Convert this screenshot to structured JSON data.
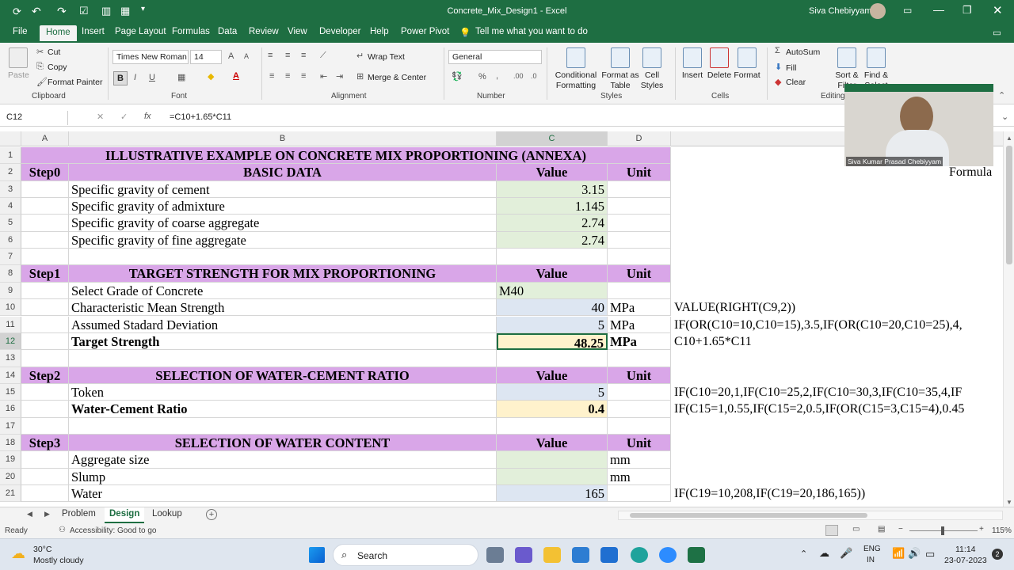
{
  "titlebar": {
    "title": "Concrete_Mix_Design1  -  Excel",
    "user": "Siva Chebiyyam"
  },
  "menu": [
    "File",
    "Home",
    "Insert",
    "Page Layout",
    "Formulas",
    "Data",
    "Review",
    "View",
    "Developer",
    "Help",
    "Power Pivot"
  ],
  "tell_me": "Tell me what you want to do",
  "ribbon": {
    "cut": "Cut",
    "copy": "Copy",
    "format_painter": "Format Painter",
    "paste": "Paste",
    "font_name": "Times New Roman",
    "font_size": "14",
    "wrap_text": "Wrap Text",
    "merge_center": "Merge & Center",
    "number_format": "General",
    "conditional_formatting": "Conditional Formatting",
    "format_as_table": "Format as Table",
    "cell_styles": "Cell Styles",
    "insert": "Insert",
    "delete": "Delete",
    "format": "Format",
    "autosum": "AutoSum",
    "fill": "Fill",
    "clear": "Clear",
    "sort_filter": "Sort & Filter",
    "find_select": "Find & Select",
    "groups": {
      "clipboard": "Clipboard",
      "font": "Font",
      "alignment": "Alignment",
      "number": "Number",
      "styles": "Styles",
      "cells": "Cells",
      "editing": "Editing"
    }
  },
  "formula_bar": {
    "name_box": "C12",
    "formula": "=C10+1.65*C11"
  },
  "columns": [
    "A",
    "B",
    "C",
    "D"
  ],
  "rows": [
    {
      "n": "1",
      "title": "ILLUSTRATIVE EXAMPLE ON CONCRETE MIX PROPORTIONING (ANNEXA)"
    },
    {
      "n": "2",
      "a": "Step0",
      "b": "BASIC DATA",
      "c": "Value",
      "d": "Unit",
      "f": "Formula"
    },
    {
      "n": "3",
      "b": "Specific gravity of cement",
      "c": "3.15"
    },
    {
      "n": "4",
      "b": "Specific gravity of admixture",
      "c": "1.145"
    },
    {
      "n": "5",
      "b": "Specific gravity of coarse aggregate",
      "c": "2.74"
    },
    {
      "n": "6",
      "b": "Specific gravity of fine aggregate",
      "c": "2.74"
    },
    {
      "n": "7"
    },
    {
      "n": "8",
      "a": "Step1",
      "b": "TARGET STRENGTH FOR MIX PROPORTIONING",
      "c": "Value",
      "d": "Unit"
    },
    {
      "n": "9",
      "b": "Select Grade of Concrete",
      "c": "M40"
    },
    {
      "n": "10",
      "b": "Characteristic Mean Strength",
      "c": "40",
      "d": "MPa",
      "f": "VALUE(RIGHT(C9,2))"
    },
    {
      "n": "11",
      "b": "Assumed Stadard Deviation",
      "c": "5",
      "d": "MPa",
      "f": "IF(OR(C10=10,C10=15),3.5,IF(OR(C10=20,C10=25),4,"
    },
    {
      "n": "12",
      "b": "Target Strength",
      "c": "48.25",
      "d": "MPa",
      "f": "C10+1.65*C11"
    },
    {
      "n": "13"
    },
    {
      "n": "14",
      "a": "Step2",
      "b": "SELECTION OF WATER-CEMENT RATIO",
      "c": "Value",
      "d": "Unit"
    },
    {
      "n": "15",
      "b": "Token",
      "c": "5",
      "f": "IF(C10=20,1,IF(C10=25,2,IF(C10=30,3,IF(C10=35,4,IF"
    },
    {
      "n": "16",
      "b": "Water-Cement Ratio",
      "c": "0.4",
      "f": "IF(C15=1,0.55,IF(C15=2,0.5,IF(OR(C15=3,C15=4),0.45"
    },
    {
      "n": "17"
    },
    {
      "n": "18",
      "a": "Step3",
      "b": "SELECTION OF WATER CONTENT",
      "c": "Value",
      "d": "Unit"
    },
    {
      "n": "19",
      "b": "Aggregate size",
      "d": "mm"
    },
    {
      "n": "20",
      "b": "Slump",
      "d": "mm"
    },
    {
      "n": "21",
      "b": "Water",
      "c": "165",
      "f": "IF(C19=10,208,IF(C19=20,186,165))"
    }
  ],
  "sheets": [
    "Problem",
    "Design",
    "Lookup"
  ],
  "status": {
    "ready": "Ready",
    "accessibility": "Accessibility: Good to go",
    "zoom": "115%"
  },
  "webcam_name": "Siva Kumar Prasad Chebiyyam",
  "taskbar": {
    "weather_temp": "30°C",
    "weather_desc": "Mostly cloudy",
    "search": "Search",
    "lang1": "ENG",
    "lang2": "IN",
    "time": "11:14",
    "date": "23-07-2023"
  }
}
